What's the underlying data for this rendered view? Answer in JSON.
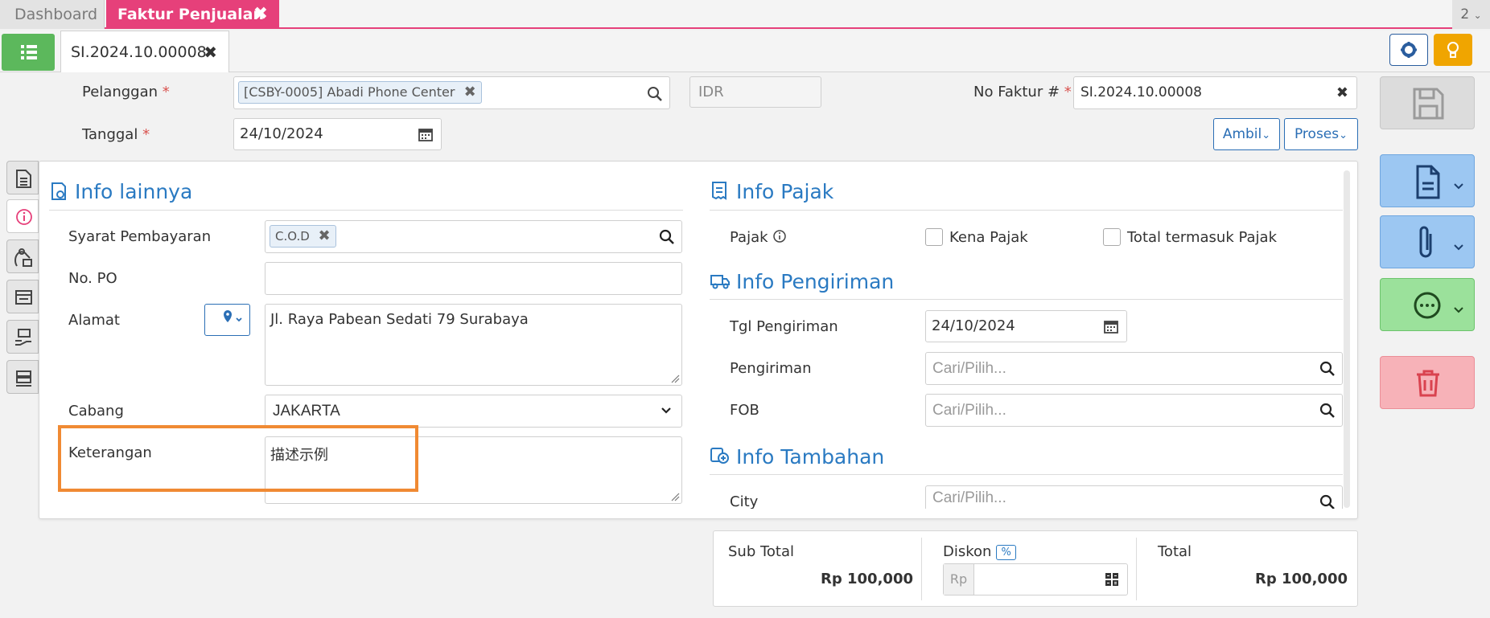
{
  "tabs": {
    "dashboard": "Dashboard",
    "faktur": "Faktur Penjualan",
    "count": "2"
  },
  "doc_tab": {
    "label": "SI.2024.10.00008"
  },
  "header": {
    "pelanggan_label": "Pelanggan",
    "pelanggan_value": "[CSBY-0005] Abadi Phone Center",
    "currency": "IDR",
    "no_faktur_label": "No Faktur #",
    "no_faktur_value": "SI.2024.10.00008",
    "tanggal_label": "Tanggal",
    "tanggal_value": "24/10/2024",
    "ambil_label": "Ambil",
    "proses_label": "Proses",
    "required_mark": "*"
  },
  "info_lainnya": {
    "title": "Info lainnya",
    "syarat_label": "Syarat Pembayaran",
    "syarat_value": "C.O.D",
    "po_label": "No. PO",
    "po_value": "",
    "alamat_label": "Alamat",
    "alamat_value": "Jl. Raya Pabean Sedati 79 Surabaya",
    "cabang_label": "Cabang",
    "cabang_value": "JAKARTA",
    "keterangan_label": "Keterangan",
    "keterangan_value": "描述示例"
  },
  "info_pajak": {
    "title": "Info Pajak",
    "pajak_label": "Pajak",
    "kena_pajak": "Kena Pajak",
    "total_termasuk": "Total termasuk Pajak"
  },
  "info_pengiriman": {
    "title": "Info Pengiriman",
    "tgl_label": "Tgl Pengiriman",
    "tgl_value": "24/10/2024",
    "pengiriman_label": "Pengiriman",
    "fob_label": "FOB",
    "placeholder": "Cari/Pilih..."
  },
  "info_tambahan": {
    "title": "Info Tambahan",
    "city_label": "City"
  },
  "totals": {
    "subtotal_label": "Sub Total",
    "subtotal_value": "Rp 100,000",
    "diskon_label": "Diskon",
    "diskon_pct": "%",
    "diskon_prefix": "Rp",
    "total_label": "Total",
    "total_value": "Rp 100,000"
  }
}
